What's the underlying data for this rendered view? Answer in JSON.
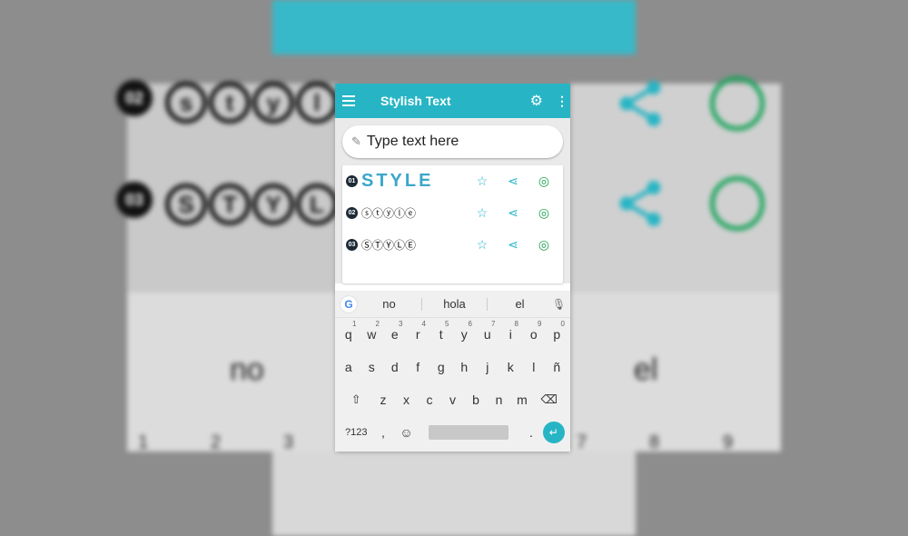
{
  "app": {
    "title": "Stylish Text",
    "settings_icon": "gear-icon",
    "overflow_icon": "more-vert-icon",
    "menu_icon": "hamburger-icon"
  },
  "search": {
    "placeholder": "Type text here"
  },
  "styles": [
    {
      "num": "01",
      "text": "STYLE"
    },
    {
      "num": "02",
      "text": "ⓢⓣⓨⓛⓔ"
    },
    {
      "num": "03",
      "text": "ⓈⓉⓎⓁⒺ"
    }
  ],
  "keyboard": {
    "suggestions": [
      "no",
      "hola",
      "el"
    ],
    "row1": [
      {
        "k": "q",
        "s": "1"
      },
      {
        "k": "w",
        "s": "2"
      },
      {
        "k": "e",
        "s": "3"
      },
      {
        "k": "r",
        "s": "4"
      },
      {
        "k": "t",
        "s": "5"
      },
      {
        "k": "y",
        "s": "6"
      },
      {
        "k": "u",
        "s": "7"
      },
      {
        "k": "i",
        "s": "8"
      },
      {
        "k": "o",
        "s": "9"
      },
      {
        "k": "p",
        "s": "0"
      }
    ],
    "row2": [
      "a",
      "s",
      "d",
      "f",
      "g",
      "h",
      "j",
      "k",
      "l",
      "ñ"
    ],
    "row3": [
      "z",
      "x",
      "c",
      "v",
      "b",
      "n",
      "m"
    ],
    "symbols_label": "?123",
    "comma": ",",
    "period": "."
  },
  "background": {
    "left_circles": [
      "s",
      "t",
      "y",
      "l"
    ],
    "left_circles_2": [
      "S",
      "T",
      "Y",
      "L"
    ],
    "left_nums": [
      "02",
      "03"
    ],
    "suggestion_left": "no",
    "suggestion_right": "el",
    "digits_left": [
      "1",
      "2",
      "3"
    ],
    "digits_right": [
      "7",
      "8",
      "9"
    ]
  },
  "colors": {
    "accent": "#27b5c5",
    "whatsapp": "#1e9e52",
    "style_blue": "#3aa7c9"
  }
}
